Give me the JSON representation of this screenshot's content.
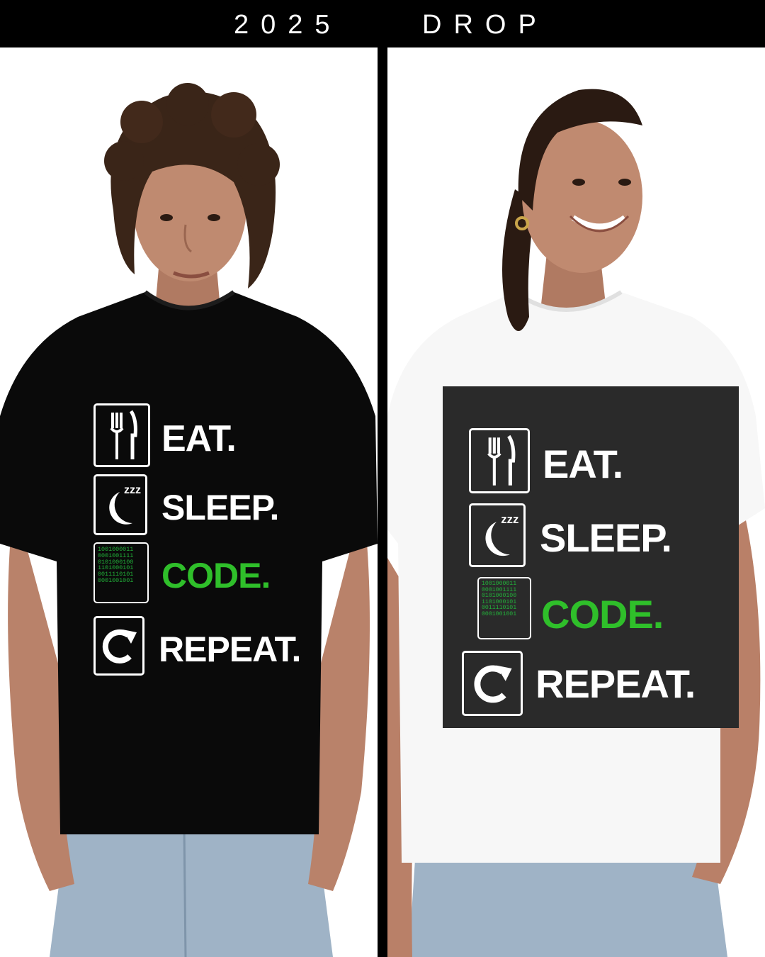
{
  "banner": {
    "year": "2025",
    "word": "DROP"
  },
  "shirt_graphic": {
    "lines": [
      "EAT.",
      "SLEEP.",
      "CODE.",
      "REPEAT."
    ],
    "binary_lines": [
      "1001000011",
      "0001001111",
      "0101000100",
      "1101000101",
      "0011110101",
      "0001001001"
    ],
    "sleep_icon_text": "zzz"
  },
  "colors": {
    "banner_bg": "#000000",
    "banner_text": "#ffffff",
    "black_shirt": "#0a0a0a",
    "white_shirt": "#f7f7f7",
    "print_square": "#2a2a2a",
    "code_green": "#2fbf2a",
    "binary_green": "#22b33a"
  },
  "icons": [
    "fork-knife-icon",
    "moon-sleep-icon",
    "binary-code-icon",
    "repeat-arrow-icon"
  ]
}
